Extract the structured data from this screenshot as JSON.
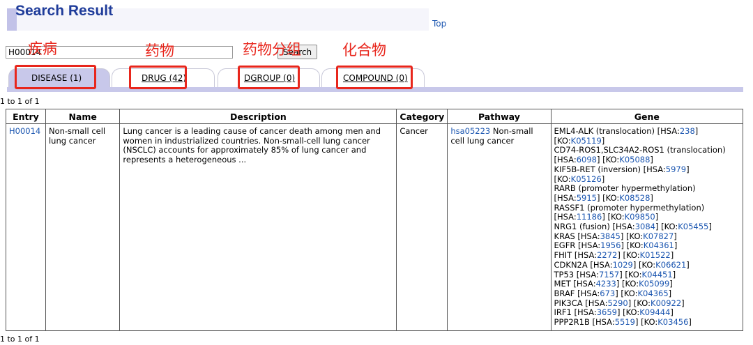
{
  "header": {
    "title": "Search Result",
    "top_link": "Top"
  },
  "search": {
    "value": "H00014",
    "button_label": "Search"
  },
  "tabs": [
    {
      "label": "DISEASE (1)",
      "active": true
    },
    {
      "label": "DRUG (42)",
      "active": false
    },
    {
      "label": "DGROUP (0)",
      "active": false
    },
    {
      "label": "COMPOUND (0)",
      "active": false
    }
  ],
  "annotations": [
    "疾病",
    "药物",
    "药物分组",
    "化合物"
  ],
  "result_count_top": "1 to 1 of 1",
  "result_count_bottom": "1 to 1 of 1",
  "table": {
    "columns": [
      "Entry",
      "Name",
      "Description",
      "Category",
      "Pathway",
      "Gene"
    ],
    "row": {
      "entry": "H00014",
      "name": "Non-small cell lung cancer",
      "description": "Lung cancer is a leading cause of cancer death among men and women in industrialized countries. Non-small-cell lung cancer (NSCLC) accounts for approximately 85% of lung cancer and represents a heterogeneous ...",
      "category": "Cancer",
      "pathway_id": "hsa05223",
      "pathway_name": "Non-small cell lung cancer",
      "genes": [
        {
          "name": "EML4-ALK (translocation)",
          "hsa": "238",
          "ko": "K05119"
        },
        {
          "name": "CD74-ROS1,SLC34A2-ROS1 (translocation)",
          "hsa": "6098",
          "ko": "K05088"
        },
        {
          "name": "KIF5B-RET (inversion)",
          "hsa": "5979",
          "ko": "K05126"
        },
        {
          "name": "RARB (promoter hypermethylation)",
          "hsa": "5915",
          "ko": "K08528"
        },
        {
          "name": "RASSF1 (promoter hypermethylation)",
          "hsa": "11186",
          "ko": "K09850"
        },
        {
          "name": "NRG1 (fusion)",
          "hsa": "3084",
          "ko": "K05455"
        },
        {
          "name": "KRAS",
          "hsa": "3845",
          "ko": "K07827"
        },
        {
          "name": "EGFR",
          "hsa": "1956",
          "ko": "K04361"
        },
        {
          "name": "FHIT",
          "hsa": "2272",
          "ko": "K01522"
        },
        {
          "name": "CDKN2A",
          "hsa": "1029",
          "ko": "K06621"
        },
        {
          "name": "TP53",
          "hsa": "7157",
          "ko": "K04451"
        },
        {
          "name": "MET",
          "hsa": "4233",
          "ko": "K05099"
        },
        {
          "name": "BRAF",
          "hsa": "673",
          "ko": "K04365"
        },
        {
          "name": "PIK3CA",
          "hsa": "5290",
          "ko": "K00922"
        },
        {
          "name": "IRF1",
          "hsa": "3659",
          "ko": "K09444"
        },
        {
          "name": "PPP2R1B",
          "hsa": "5519",
          "ko": "K03456"
        }
      ]
    }
  },
  "colors": {
    "title": "#1f3c9a",
    "link": "#1a55b0",
    "annotation": "#e8261c",
    "tab_active": "#c8c8ea"
  }
}
